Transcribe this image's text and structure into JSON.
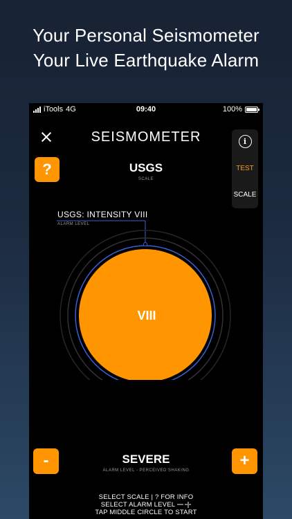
{
  "promo": {
    "line1": "Your Personal Seismometer",
    "line2": "Your Live Earthquake Alarm"
  },
  "status_bar": {
    "carrier": "iTools",
    "network": "4G",
    "time": "09:40",
    "battery": "100%"
  },
  "header": {
    "title": "SEISMOMETER",
    "close_icon": "close-icon"
  },
  "side_panel": {
    "info_label": "i",
    "test_label": "TEST",
    "scale_label": "SCALE"
  },
  "help_button": {
    "label": "?"
  },
  "scale": {
    "name": "USGS",
    "caption": "SCALE"
  },
  "alarm": {
    "value": "USGS: INTENSITY VIII",
    "caption": "ALARM LEVEL"
  },
  "dial": {
    "label": "VIII"
  },
  "level": {
    "name": "SEVERE",
    "caption": "ALARM LEVEL - PERCEIVED SHAKING",
    "minus_label": "-",
    "plus_label": "+"
  },
  "instructions": {
    "line1": "SELECT SCALE | ? FOR INFO",
    "line2": "SELECT ALARM LEVEL",
    "line3": "TAP MIDDLE CIRCLE TO START"
  },
  "colors": {
    "accent": "#ff9500",
    "test_text": "#f0a01c",
    "ring_blue": "#3a5fd0",
    "background": "#000000"
  }
}
